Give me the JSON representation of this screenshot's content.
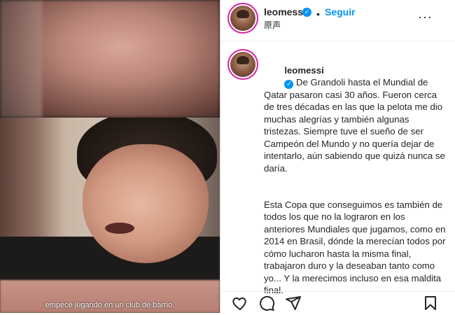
{
  "media": {
    "subtitle": "empecé jugando en un club de barrio."
  },
  "header": {
    "username": "leomessi",
    "verified_glyph": "✓",
    "separator": "•",
    "follow_label": "Seguir",
    "original_audio": "原声",
    "more_label": "···"
  },
  "caption": {
    "username": "leomessi",
    "verified_glyph": "✓",
    "paragraph1": " De Grandoli hasta el Mundial de Qatar pasaron casi 30 años. Fueron cerca de tres décadas en las que la pelota me dio muchas alegrías y también algunas tristezas. Siempre tuve el sueño de ser Campeón del Mundo y no quería dejar de intentarlo, aún sabiendo que quizá nunca se daría.",
    "paragraph2": "Esta Copa que conseguimos es también de todos los que no la lograron en los anteriores Mundiales que jugamos, como en 2014 en Brasil, dónde la merecían todos por cómo lucharon hasta la misma final, trabajaron duro y la deseaban tanto como yo... Y la merecimos incluso en esa maldita final."
  },
  "actions": {
    "icons": [
      "heart-icon",
      "comment-icon",
      "share-icon",
      "bookmark-icon"
    ]
  },
  "colors": {
    "accent": "#0095f6",
    "text": "#262626",
    "story_ring": "#d6249f"
  }
}
